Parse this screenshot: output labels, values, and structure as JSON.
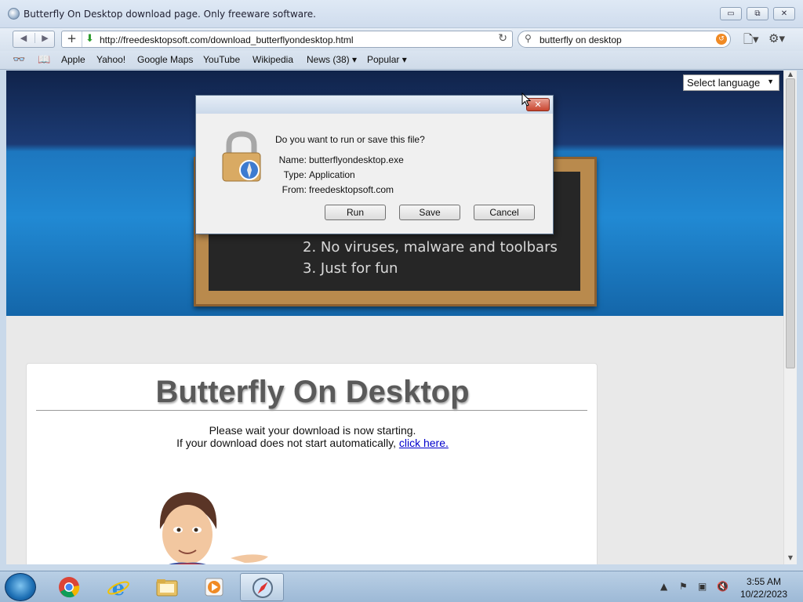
{
  "window": {
    "title": "Butterfly On Desktop download page. Only freeware software.",
    "minimize_label": "▭",
    "restore_label": "⧉",
    "close_label": "✕"
  },
  "nav": {
    "url": "http://freedesktopsoft.com/download_butterflyondesktop.html",
    "search_value": "butterfly on desktop"
  },
  "bookmarks": [
    {
      "label": "Apple"
    },
    {
      "label": "Yahoo!"
    },
    {
      "label": "Google Maps"
    },
    {
      "label": "YouTube"
    },
    {
      "label": "Wikipedia"
    },
    {
      "label": "News (38) ▾"
    },
    {
      "label": "Popular ▾"
    }
  ],
  "page": {
    "language_select": "Select language",
    "board_lines": [
      "2. No viruses, malware and toolbars",
      "3. Just for fun"
    ],
    "heading": "Butterfly On Desktop",
    "wait_message": "Please wait your download is now starting.",
    "fallback_prefix": "If your download does not start automatically,",
    "fallback_link": "click here."
  },
  "dialog": {
    "question": "Do you want to run or save this file?",
    "name_key": "Name:",
    "name_value": "butterflyondesktop.exe",
    "type_key": "Type:",
    "type_value": "Application",
    "from_key": "From:",
    "from_value": "freedesktopsoft.com",
    "buttons": {
      "run": "Run",
      "save": "Save",
      "cancel": "Cancel"
    }
  },
  "taskbar": {
    "time": "3:55 AM",
    "date": "10/22/2023",
    "apps": [
      "chrome-icon",
      "internet-explorer-icon",
      "file-explorer-icon",
      "media-player-icon",
      "safari-icon"
    ]
  },
  "colors": {
    "dialog_close": "#c8452f",
    "hero_blue": "#2189d3",
    "link": "#0000cc"
  }
}
